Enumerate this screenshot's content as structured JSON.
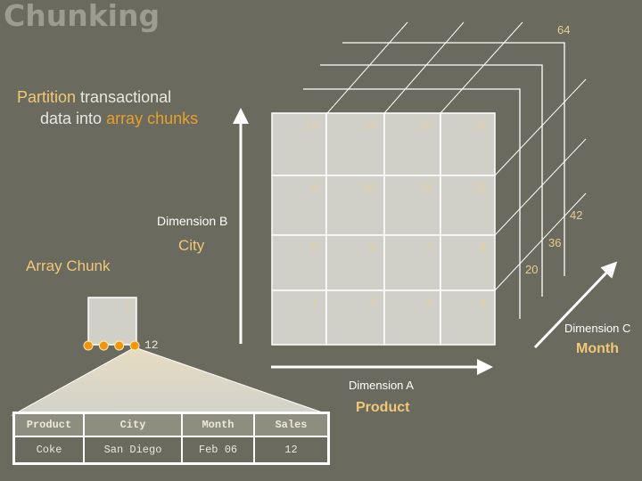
{
  "slide": {
    "title": "Chunking",
    "subtitle": {
      "part1_highlight": "Partition",
      "part1_rest": " transactional",
      "part2_plain": "data into ",
      "part2_highlight": "array chunks"
    }
  },
  "dimensions": {
    "a": {
      "label": "Dimension A",
      "name": "Product"
    },
    "b": {
      "label": "Dimension B",
      "name": "City"
    },
    "c": {
      "label": "Dimension C",
      "name": "Month"
    }
  },
  "array_chunk": {
    "label": "Array Chunk",
    "chunk_id": "1",
    "value_label": "12",
    "dot_count": 4
  },
  "cube": {
    "front_grid": [
      [
        "13",
        "14",
        "15",
        "16"
      ],
      [
        "9",
        "10",
        "11",
        "12"
      ],
      [
        "5",
        "6",
        "7",
        "8"
      ],
      [
        "1",
        "2",
        "3",
        "4"
      ]
    ],
    "depth_labels": [
      "20",
      "36",
      "42",
      "64"
    ]
  },
  "record_table": {
    "headers": [
      "Product",
      "City",
      "Month",
      "Sales"
    ],
    "rows": [
      [
        "Coke",
        "San Diego",
        "Feb 06",
        "12"
      ]
    ]
  },
  "colors": {
    "background": "#6a6a5e",
    "cell_fill": "#d0d0c8",
    "accent_orange": "#f0960c",
    "accent_gold": "#f0c878"
  }
}
